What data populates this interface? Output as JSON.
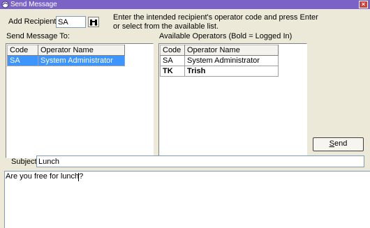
{
  "window": {
    "title": "Send Message"
  },
  "recipient": {
    "label": "Add Recipient:",
    "value": "SA"
  },
  "instructions": {
    "line1": "Enter the intended recipient's operator code and press Enter",
    "line2": "or select from the available list."
  },
  "send_to": {
    "label": "Send Message To:",
    "headers": {
      "code": "Code",
      "name": "Operator Name"
    },
    "rows": [
      {
        "code": "SA",
        "name": "System Administrator"
      }
    ]
  },
  "available": {
    "label": "Available Operators (Bold = Logged In)",
    "headers": {
      "code": "Code",
      "name": "Operator Name"
    },
    "rows": [
      {
        "code": "SA",
        "name": "System Administrator"
      },
      {
        "code": "TK",
        "name": "Trish"
      }
    ]
  },
  "send_button": {
    "label": "Send",
    "mnemonic": "S",
    "rest": "end"
  },
  "subject": {
    "label": "Subject:",
    "value": "Lunch"
  },
  "body": {
    "text": "Are you free for lunch?"
  },
  "icons": {
    "search": "binoculars-icon",
    "app": "app-icon",
    "close": "close-icon"
  }
}
